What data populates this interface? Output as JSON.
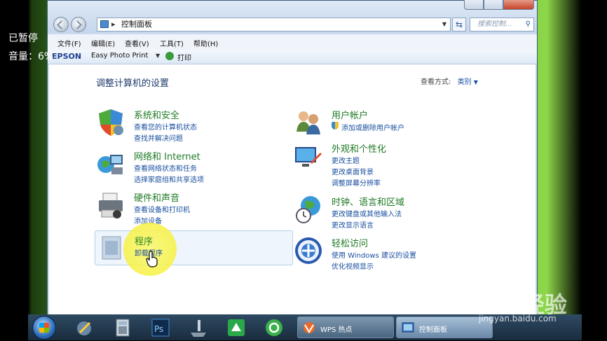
{
  "overlay": {
    "paused": "已暂停",
    "volume": "音量：6%"
  },
  "address": {
    "path": "控制面板",
    "search_placeholder": "搜索控制..."
  },
  "menu": [
    "文件(F)",
    "编辑(E)",
    "查看(V)",
    "工具(T)",
    "帮助(H)"
  ],
  "toolbar": {
    "brand": "EPSON",
    "app": "Easy Photo Print",
    "print": "打印"
  },
  "content": {
    "heading": "调整计算机的设置",
    "view_by_label": "查看方式:",
    "view_by_value": "类别",
    "left": [
      {
        "title": "系统和安全",
        "links": [
          "查看您的计算机状态",
          "查找并解决问题"
        ]
      },
      {
        "title": "网络和 Internet",
        "links": [
          "查看网络状态和任务",
          "选择家庭组和共享选项"
        ]
      },
      {
        "title": "硬件和声音",
        "links": [
          "查看设备和打印机",
          "添加设备"
        ]
      },
      {
        "title": "程序",
        "links": [
          "卸载程序"
        ]
      }
    ],
    "right": [
      {
        "title": "用户帐户",
        "links": [
          "添加或删除用户帐户"
        ]
      },
      {
        "title": "外观和个性化",
        "links": [
          "更改主题",
          "更改桌面背景",
          "调整屏幕分辨率"
        ]
      },
      {
        "title": "时钟、语言和区域",
        "links": [
          "更改键盘或其他输入法",
          "更改显示语言"
        ]
      },
      {
        "title": "轻松访问",
        "links": [
          "使用 Windows 建议的设置",
          "优化视频显示"
        ]
      }
    ]
  },
  "taskbar": {
    "wps_label": "WPS 热点",
    "control_panel_label": "控制面板"
  },
  "watermark": {
    "brand": "Bai&经验",
    "url": "jingyan.baidu.com"
  },
  "colors": {
    "accent_green": "#1e7a24",
    "link_blue": "#1a4fa0",
    "highlight": "#f7f34d"
  }
}
